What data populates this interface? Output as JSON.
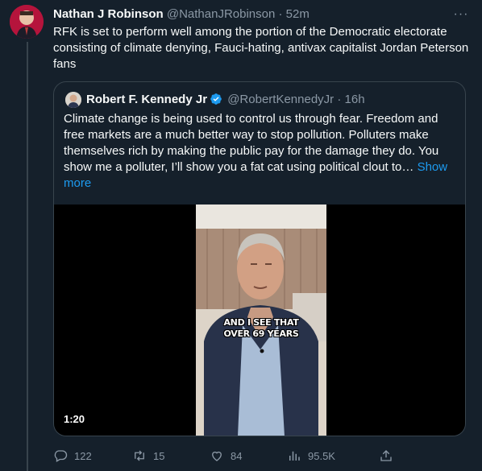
{
  "tweet": {
    "author_name": "Nathan J Robinson",
    "handle": "@NathanJRobinson",
    "separator": "·",
    "time": "52m",
    "text": "RFK is set to perform well among the portion of the Democratic electorate consisting of climate denying, Fauci-hating, antivax capitalist Jordan Peterson fans"
  },
  "quote": {
    "author_name": "Robert F. Kennedy Jr",
    "handle": "@RobertKennedyJr",
    "separator": "·",
    "time": "16h",
    "text": "Climate change is being used to control us through fear. Freedom and free markets are a much better way to stop pollution. Polluters make themselves rich by making the public pay for the damage they do. You show me a polluter, I’ll show you a fat cat using political clout to…",
    "show_more": "Show more",
    "video": {
      "caption_line1": "AND I SEE THAT",
      "caption_line2": "OVER 69 YEARS",
      "duration": "1:20"
    }
  },
  "actions": {
    "replies": "122",
    "retweets": "15",
    "likes": "84",
    "views": "95.5K"
  },
  "colors": {
    "background": "#15202b",
    "border": "#38444d",
    "text": "#f7f9f9",
    "muted": "#8b98a5",
    "link": "#1d9bf0"
  }
}
